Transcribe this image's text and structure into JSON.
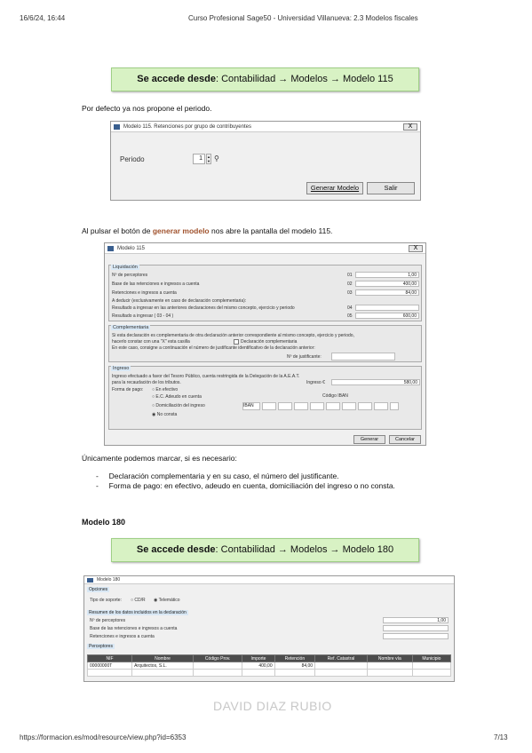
{
  "header": {
    "datetime": "16/6/24, 16:44",
    "title": "Curso Profesional Sage50 - Universidad Villanueva: 2.3 Modelos fiscales"
  },
  "banner1": {
    "prefix": "Se accede desde",
    "path": ": Contabilidad → Modelos → Modelo 115"
  },
  "para_default": "Por defecto ya nos propone el periodo.",
  "dialog1": {
    "title": "Modelo 115. Retenciones por grupo de contribuyentes",
    "close": "X",
    "period_label": "Periodo",
    "period_value": "1",
    "generate": "Generar Modelo",
    "exit": "Salir"
  },
  "para_generate": {
    "before": "Al pulsar el botón de ",
    "highlight": "generar modelo",
    "after": " nos abre la pantalla del modelo 115."
  },
  "window115": {
    "title": "Modelo 115",
    "close": "X",
    "liq_title": "Liquidación",
    "liq_rows": [
      {
        "label": "Nº de perceptores",
        "code": "01",
        "value": "1,00"
      },
      {
        "label": "Base de las retenciones e ingresos a cuenta",
        "code": "02",
        "value": "400,00"
      },
      {
        "label": "Retenciones e ingresos a cuenta",
        "code": "03",
        "value": "84,00"
      },
      {
        "label": "A deducir (exclusivamente en caso de declaración complementaria):",
        "code": "",
        "value": ""
      },
      {
        "label": "Resultado a ingresar en las anteriores declaraciones del mismo concepto, ejercicio y periodo",
        "code": "04",
        "value": ""
      },
      {
        "label": "Resultado a ingresar ( 03 - 04 )",
        "code": "05",
        "value": "600,00"
      }
    ],
    "comp_title": "Complementaria",
    "comp_text1": "Si esta declaración es complementaria de otra declaración anterior correspondiente al mismo concepto, ejercicio y periodo,",
    "comp_text2": "hacerlo constar con una \"X\" esta casilla",
    "comp_check": "Declaración complementaria",
    "comp_text3": "En este caso, consigne a continuación el número de justificante identificativo de la declaración anterior:",
    "comp_just": "Nº de justificante:",
    "ing_title": "Ingreso",
    "ing_text1": "Ingreso efectuado a favor del Tesoro Público, cuenta restringida de la Delegación de la A.E.A.T.",
    "ing_text2": "para la recaudación de los tributos.",
    "ing_label": "Ingreso €",
    "ing_value": "580,00",
    "pay_label": "Forma de pago:",
    "pay_options": [
      "En efectivo",
      "E.C. Adeudo en cuenta",
      "Domiciliación del ingreso",
      "No consta"
    ],
    "iban_label": "Código IBAN",
    "iban_value": "IBAN",
    "accept": "Generar",
    "cancel": "Cancelar"
  },
  "para_only": "Únicamente podemos marcar, si es necesario:",
  "bullets": [
    "Declaración complementaria y en su caso, el número del justificante.",
    "Forma de pago: en efectivo, adeudo en cuenta, domiciliación del ingreso o no consta."
  ],
  "heading180": "Modelo 180",
  "banner2": {
    "prefix": "Se accede desde",
    "path": ": Contabilidad → Modelos → Modelo 180"
  },
  "window180": {
    "title": "Modelo 180",
    "opts_title": "Opciones",
    "support_label": "Tipo de soporte:",
    "support_options": [
      "CD/R",
      "Telemático"
    ],
    "summary_title": "Resumen de los datos incluidos en la declaración",
    "summary_rows": [
      {
        "label": "Nº de perceptores",
        "value": "1,00"
      },
      {
        "label": "Base de las retenciones e ingresos a cuenta",
        "value": ""
      },
      {
        "label": "Retenciones e ingresos a cuenta",
        "value": ""
      }
    ],
    "perc_title": "Perceptores",
    "columns": [
      "NIF",
      "Nombre",
      "Código Prov.",
      "Importe",
      "Retención",
      "Ref. Catastral",
      "Nombre vía",
      "Municipio"
    ],
    "rows": [
      [
        "00000000T",
        "Arquitectos, S.L.",
        "",
        "400,00",
        "84,00",
        "",
        "",
        ""
      ]
    ]
  },
  "watermark": "DAVID DIAZ RUBIO",
  "footer": {
    "url": "https://formacion.es/mod/resource/view.php?id=6353",
    "page": "7/13"
  }
}
